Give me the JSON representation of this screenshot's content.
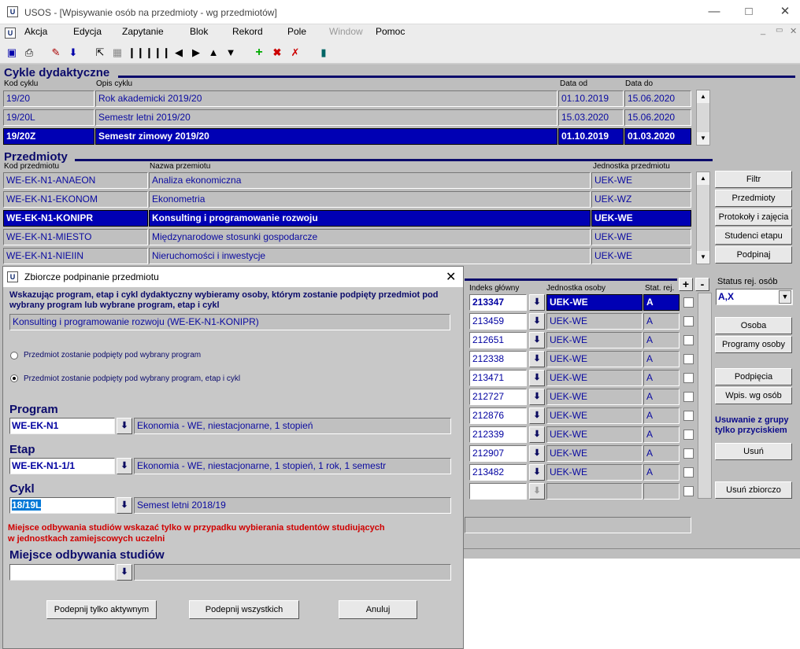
{
  "window": {
    "title": "USOS - [Wpisywanie osób na przedmioty - wg przedmiotów]",
    "app_icon": "usos-icon"
  },
  "menu": {
    "items": [
      "Akcja",
      "Edycja",
      "Zapytanie",
      "Blok",
      "Rekord",
      "Pole",
      "Window",
      "Pomoc"
    ]
  },
  "cykle": {
    "title": "Cykle dydaktyczne",
    "headers": {
      "kod": "Kod cyklu",
      "opis": "Opis cyklu",
      "od": "Data od",
      "do": "Data do"
    },
    "rows": [
      {
        "kod": "19/20",
        "opis": "Rok akademicki 2019/20",
        "od": "01.10.2019",
        "do": "15.06.2020"
      },
      {
        "kod": "19/20L",
        "opis": "Semestr letni 2019/20",
        "od": "15.03.2020",
        "do": "15.06.2020"
      },
      {
        "kod": "19/20Z",
        "opis": "Semestr zimowy 2019/20",
        "od": "01.10.2019",
        "do": "01.03.2020"
      }
    ]
  },
  "przedmioty": {
    "title": "Przedmioty",
    "headers": {
      "kod": "Kod przedmiotu",
      "nazwa": "Nazwa przemiotu",
      "jedn": "Jednostka przedmiotu"
    },
    "rows": [
      {
        "kod": "WE-EK-N1-ANAEON",
        "nazwa": "Analiza ekonomiczna",
        "jedn": "UEK-WE"
      },
      {
        "kod": "WE-EK-N1-EKONOM",
        "nazwa": "Ekonometria",
        "jedn": "UEK-WZ"
      },
      {
        "kod": "WE-EK-N1-KONIPR",
        "nazwa": "Konsulting i programowanie rozwoju",
        "jedn": "UEK-WE"
      },
      {
        "kod": "WE-EK-N1-MIESTO",
        "nazwa": "Międzynarodowe stosunki gospodarcze",
        "jedn": "UEK-WE"
      },
      {
        "kod": "WE-EK-N1-NIEIIN",
        "nazwa": "Nieruchomości i inwestycje",
        "jedn": "UEK-WE"
      }
    ]
  },
  "right_buttons": {
    "filtr": "Filtr",
    "przedmioty": "Przedmioty",
    "protokoly": "Protokoły i zajęcia",
    "studenci": "Studenci etapu",
    "podpinaj": "Podpinaj"
  },
  "osoby": {
    "headers": {
      "indeks": "Indeks główny",
      "jedn": "Jednostka osoby",
      "stat": "Stat. rej."
    },
    "plus": "+",
    "minus": "-",
    "rows": [
      {
        "indeks": "213347",
        "jedn": "UEK-WE",
        "stat": "A"
      },
      {
        "indeks": "213459",
        "jedn": "UEK-WE",
        "stat": "A"
      },
      {
        "indeks": "212651",
        "jedn": "UEK-WE",
        "stat": "A"
      },
      {
        "indeks": "212338",
        "jedn": "UEK-WE",
        "stat": "A"
      },
      {
        "indeks": "213471",
        "jedn": "UEK-WE",
        "stat": "A"
      },
      {
        "indeks": "212727",
        "jedn": "UEK-WE",
        "stat": "A"
      },
      {
        "indeks": "212876",
        "jedn": "UEK-WE",
        "stat": "A"
      },
      {
        "indeks": "212339",
        "jedn": "UEK-WE",
        "stat": "A"
      },
      {
        "indeks": "212907",
        "jedn": "UEK-WE",
        "stat": "A"
      },
      {
        "indeks": "213482",
        "jedn": "UEK-WE",
        "stat": "A"
      }
    ]
  },
  "side": {
    "status_label": "Status rej. osób",
    "status_value": "A,X",
    "osoba": "Osoba",
    "programy_osoby": "Programy osoby",
    "podpiecia": "Podpięcia",
    "wpis": "Wpis. wg osób",
    "usuwanie_note": "Usuwanie z grupy tylko przyciskiem",
    "usun": "Usuń",
    "usun_zbiorczo": "Usuń zbiorczo"
  },
  "dialog": {
    "title": "Zbiorcze podpinanie przedmiotu",
    "info": "Wskazując program, etap i cykl dydaktyczny wybieramy osoby, którym zostanie podpięty przedmiot pod wybrany program lub wybrane program, etap i cykl",
    "subject": "Konsulting i programowanie rozwoju (WE-EK-N1-KONIPR)",
    "radio1": "Przedmiot zostanie podpięty pod wybrany program",
    "radio2": "Przedmiot zostanie podpięty pod wybrany program, etap i cykl",
    "program_label": "Program",
    "program_value": "WE-EK-N1",
    "program_desc": "Ekonomia - WE, niestacjonarne, 1 stopień",
    "etap_label": "Etap",
    "etap_value": "WE-EK-N1-1/1",
    "etap_desc": "Ekonomia - WE, niestacjonarne, 1 stopień, 1 rok, 1 semestr",
    "cykl_label": "Cykl",
    "cykl_value": "18/19L",
    "cykl_desc": "Semest letni 2018/19",
    "warning1": "Miejsce odbywania studiów wskazać tylko w przypadku wybierania studentów studiujących",
    "warning2": "w jednostkach zamiejscowych uczelni",
    "miejsce_label": "Miejsce odbywania studiów",
    "btn_aktywnym": "Podepnij tylko aktywnym",
    "btn_wszystkich": "Podepnij wszystkich",
    "btn_anuluj": "Anuluj"
  }
}
